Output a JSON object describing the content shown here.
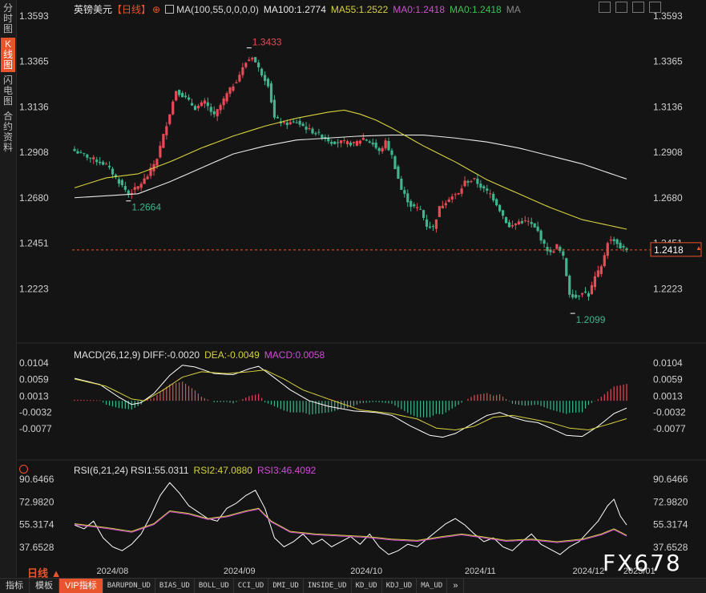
{
  "sidebar": {
    "tabs": [
      {
        "label": "分时图",
        "active": false
      },
      {
        "label": "K线图",
        "active": true
      },
      {
        "label": "闪电图",
        "active": false
      },
      {
        "label": "合约资料",
        "active": false
      }
    ]
  },
  "header": {
    "instrument": "英镑美元",
    "period_tag": "【日线】",
    "plus_symbol": "⊕",
    "ma_params": "MA(100,55,0,0,0,0)",
    "ma100": "MA100:1.2774",
    "ma55": "MA55:1.2522",
    "ma0a": "MA0:1.2418",
    "ma0b": "MA0:1.2418",
    "ma_tag": "MA"
  },
  "macd_legend": {
    "params": "MACD(26,12,9)",
    "diff": "DIFF:-0.0020",
    "dea": "DEA:-0.0049",
    "macd": "MACD:0.0058"
  },
  "rsi_legend": {
    "params": "RSI(6,21,24)",
    "rsi1": "RSI1:55.0311",
    "rsi2": "RSI2:47.0880",
    "rsi3": "RSI3:46.4092"
  },
  "colors": {
    "up": "#e84b55",
    "down": "#3fb58d",
    "ma100": "#e8e8e8",
    "ma55": "#d6d23e",
    "accent": "#e8542b",
    "rsi2": "#d6d23e",
    "rsi3": "#d24bd6"
  },
  "chart_data": [
    {
      "type": "candlestick",
      "title": "英镑美元【日线】",
      "y_ticks": [
        "1.3593",
        "1.3365",
        "1.3136",
        "1.2908",
        "1.2680",
        "1.2451",
        "1.2223"
      ],
      "ylim": [
        1.2063,
        1.3593
      ],
      "x_ticks": [
        "2024/08",
        "2024/09",
        "2024/10",
        "2024/11",
        "2024/12",
        "2025/01"
      ],
      "current_price": "1.2418",
      "annotations": [
        {
          "label": "1.3433",
          "kind": "high"
        },
        {
          "label": "1.2664",
          "kind": "low"
        },
        {
          "label": "1.2099",
          "kind": "low"
        }
      ],
      "close_anchors": [
        [
          0,
          1.2915
        ],
        [
          5,
          1.288
        ],
        [
          10,
          1.2845
        ],
        [
          14,
          1.276
        ],
        [
          17,
          1.27
        ],
        [
          20,
          1.2735
        ],
        [
          23,
          1.279
        ],
        [
          26,
          1.288
        ],
        [
          29,
          1.305
        ],
        [
          32,
          1.322
        ],
        [
          35,
          1.318
        ],
        [
          38,
          1.313
        ],
        [
          41,
          1.316
        ],
        [
          44,
          1.309
        ],
        [
          48,
          1.32
        ],
        [
          51,
          1.327
        ],
        [
          54,
          1.336
        ],
        [
          56,
          1.339
        ],
        [
          58,
          1.333
        ],
        [
          61,
          1.325
        ],
        [
          63,
          1.308
        ],
        [
          66,
          1.305
        ],
        [
          70,
          1.306
        ],
        [
          74,
          1.302
        ],
        [
          78,
          1.299
        ],
        [
          81,
          1.296
        ],
        [
          84,
          1.296
        ],
        [
          88,
          1.295
        ],
        [
          91,
          1.298
        ],
        [
          94,
          1.295
        ],
        [
          96,
          1.291
        ],
        [
          98,
          1.296
        ],
        [
          100,
          1.289
        ],
        [
          103,
          1.272
        ],
        [
          106,
          1.264
        ],
        [
          109,
          1.262
        ],
        [
          111,
          1.254
        ],
        [
          113,
          1.253
        ],
        [
          115,
          1.263
        ],
        [
          118,
          1.268
        ],
        [
          121,
          1.27
        ],
        [
          123,
          1.276
        ],
        [
          126,
          1.277
        ],
        [
          129,
          1.272
        ],
        [
          131,
          1.27
        ],
        [
          133,
          1.265
        ],
        [
          135,
          1.259
        ],
        [
          137,
          1.253
        ],
        [
          140,
          1.256
        ],
        [
          143,
          1.256
        ],
        [
          146,
          1.251
        ],
        [
          148,
          1.244
        ],
        [
          150,
          1.24
        ],
        [
          152,
          1.244
        ],
        [
          154,
          1.238
        ],
        [
          156,
          1.22
        ],
        [
          158,
          1.218
        ],
        [
          160,
          1.221
        ],
        [
          162,
          1.219
        ],
        [
          164,
          1.228
        ],
        [
          166,
          1.233
        ],
        [
          168,
          1.246
        ],
        [
          170,
          1.247
        ],
        [
          172,
          1.243
        ],
        [
          174,
          1.2418
        ]
      ],
      "ma100": [
        [
          0,
          1.268
        ],
        [
          10,
          1.269
        ],
        [
          20,
          1.27
        ],
        [
          30,
          1.276
        ],
        [
          40,
          1.283
        ],
        [
          50,
          1.29
        ],
        [
          60,
          1.294
        ],
        [
          70,
          1.297
        ],
        [
          80,
          1.298
        ],
        [
          90,
          1.299
        ],
        [
          100,
          1.2995
        ],
        [
          110,
          1.2995
        ],
        [
          120,
          1.298
        ],
        [
          130,
          1.296
        ],
        [
          140,
          1.293
        ],
        [
          150,
          1.289
        ],
        [
          160,
          1.285
        ],
        [
          174,
          1.2774
        ]
      ],
      "ma55": [
        [
          0,
          1.273
        ],
        [
          10,
          1.278
        ],
        [
          20,
          1.28
        ],
        [
          30,
          1.286
        ],
        [
          40,
          1.293
        ],
        [
          50,
          1.299
        ],
        [
          60,
          1.304
        ],
        [
          70,
          1.308
        ],
        [
          80,
          1.311
        ],
        [
          85,
          1.312
        ],
        [
          90,
          1.31
        ],
        [
          95,
          1.307
        ],
        [
          100,
          1.303
        ],
        [
          110,
          1.294
        ],
        [
          120,
          1.286
        ],
        [
          130,
          1.277
        ],
        [
          140,
          1.27
        ],
        [
          150,
          1.263
        ],
        [
          160,
          1.257
        ],
        [
          174,
          1.2522
        ]
      ]
    },
    {
      "type": "macd",
      "title": "MACD(26,12,9)",
      "y_ticks": [
        "0.0104",
        "0.0059",
        "0.0013",
        "-0.0032",
        "-0.0077"
      ],
      "ylim": [
        -0.0112,
        0.0104
      ],
      "diff": [
        [
          0,
          0.0062
        ],
        [
          8,
          0.0045
        ],
        [
          14,
          0.001
        ],
        [
          18,
          -0.001
        ],
        [
          21,
          -0.0005
        ],
        [
          25,
          0.002
        ],
        [
          30,
          0.007
        ],
        [
          34,
          0.0098
        ],
        [
          38,
          0.0093
        ],
        [
          44,
          0.0075
        ],
        [
          50,
          0.0072
        ],
        [
          55,
          0.0088
        ],
        [
          58,
          0.0095
        ],
        [
          62,
          0.007
        ],
        [
          68,
          0.003
        ],
        [
          74,
          0.0
        ],
        [
          80,
          -0.0015
        ],
        [
          88,
          -0.0028
        ],
        [
          95,
          -0.0032
        ],
        [
          100,
          -0.004
        ],
        [
          106,
          -0.007
        ],
        [
          112,
          -0.0095
        ],
        [
          116,
          -0.01
        ],
        [
          120,
          -0.009
        ],
        [
          126,
          -0.006
        ],
        [
          130,
          -0.004
        ],
        [
          134,
          -0.0032
        ],
        [
          138,
          -0.0045
        ],
        [
          142,
          -0.0055
        ],
        [
          146,
          -0.006
        ],
        [
          150,
          -0.0075
        ],
        [
          155,
          -0.0095
        ],
        [
          160,
          -0.0098
        ],
        [
          165,
          -0.007
        ],
        [
          170,
          -0.0035
        ],
        [
          174,
          -0.002
        ]
      ],
      "dea": [
        [
          0,
          0.006
        ],
        [
          10,
          0.004
        ],
        [
          18,
          0.0005
        ],
        [
          22,
          0.0
        ],
        [
          28,
          0.003
        ],
        [
          34,
          0.0065
        ],
        [
          40,
          0.008
        ],
        [
          48,
          0.0075
        ],
        [
          55,
          0.008
        ],
        [
          60,
          0.0085
        ],
        [
          66,
          0.006
        ],
        [
          72,
          0.003
        ],
        [
          80,
          0.0005
        ],
        [
          90,
          -0.0025
        ],
        [
          100,
          -0.0035
        ],
        [
          108,
          -0.005
        ],
        [
          114,
          -0.0075
        ],
        [
          120,
          -0.008
        ],
        [
          126,
          -0.007
        ],
        [
          132,
          -0.0045
        ],
        [
          138,
          -0.004
        ],
        [
          144,
          -0.005
        ],
        [
          150,
          -0.006
        ],
        [
          156,
          -0.0075
        ],
        [
          162,
          -0.008
        ],
        [
          168,
          -0.0065
        ],
        [
          174,
          -0.0049
        ]
      ]
    },
    {
      "type": "rsi",
      "title": "RSI(6,21,24)",
      "y_ticks": [
        "90.6466",
        "72.9820",
        "55.3174",
        "37.6528"
      ],
      "ylim": [
        27.0,
        90.6466
      ],
      "rsi1_anchors": [
        [
          0,
          55
        ],
        [
          3,
          52
        ],
        [
          6,
          58
        ],
        [
          9,
          45
        ],
        [
          12,
          38
        ],
        [
          15,
          35
        ],
        [
          18,
          40
        ],
        [
          21,
          48
        ],
        [
          24,
          62
        ],
        [
          27,
          78
        ],
        [
          30,
          88
        ],
        [
          33,
          80
        ],
        [
          36,
          70
        ],
        [
          39,
          65
        ],
        [
          42,
          60
        ],
        [
          45,
          58
        ],
        [
          48,
          68
        ],
        [
          51,
          72
        ],
        [
          54,
          78
        ],
        [
          57,
          82
        ],
        [
          60,
          68
        ],
        [
          63,
          45
        ],
        [
          66,
          38
        ],
        [
          69,
          42
        ],
        [
          72,
          48
        ],
        [
          75,
          40
        ],
        [
          78,
          44
        ],
        [
          81,
          38
        ],
        [
          84,
          42
        ],
        [
          87,
          46
        ],
        [
          90,
          40
        ],
        [
          93,
          48
        ],
        [
          96,
          38
        ],
        [
          99,
          32
        ],
        [
          102,
          35
        ],
        [
          105,
          40
        ],
        [
          108,
          38
        ],
        [
          111,
          44
        ],
        [
          114,
          50
        ],
        [
          117,
          56
        ],
        [
          120,
          60
        ],
        [
          123,
          55
        ],
        [
          126,
          48
        ],
        [
          129,
          42
        ],
        [
          132,
          45
        ],
        [
          135,
          38
        ],
        [
          138,
          35
        ],
        [
          141,
          42
        ],
        [
          144,
          48
        ],
        [
          147,
          40
        ],
        [
          150,
          36
        ],
        [
          153,
          32
        ],
        [
          156,
          38
        ],
        [
          159,
          42
        ],
        [
          162,
          50
        ],
        [
          165,
          58
        ],
        [
          168,
          70
        ],
        [
          170,
          75
        ],
        [
          172,
          62
        ],
        [
          174,
          55
        ]
      ],
      "rsi2_anchors": [
        [
          0,
          56
        ],
        [
          10,
          53
        ],
        [
          18,
          50
        ],
        [
          25,
          56
        ],
        [
          30,
          66
        ],
        [
          36,
          64
        ],
        [
          42,
          60
        ],
        [
          48,
          62
        ],
        [
          54,
          66
        ],
        [
          58,
          68
        ],
        [
          62,
          58
        ],
        [
          68,
          50
        ],
        [
          76,
          48
        ],
        [
          84,
          47
        ],
        [
          92,
          46
        ],
        [
          100,
          44
        ],
        [
          108,
          43
        ],
        [
          116,
          46
        ],
        [
          122,
          48
        ],
        [
          128,
          46
        ],
        [
          136,
          43
        ],
        [
          144,
          44
        ],
        [
          152,
          42
        ],
        [
          160,
          44
        ],
        [
          166,
          48
        ],
        [
          170,
          52
        ],
        [
          174,
          47
        ]
      ],
      "rsi3_offset": -0.7
    }
  ]
}
